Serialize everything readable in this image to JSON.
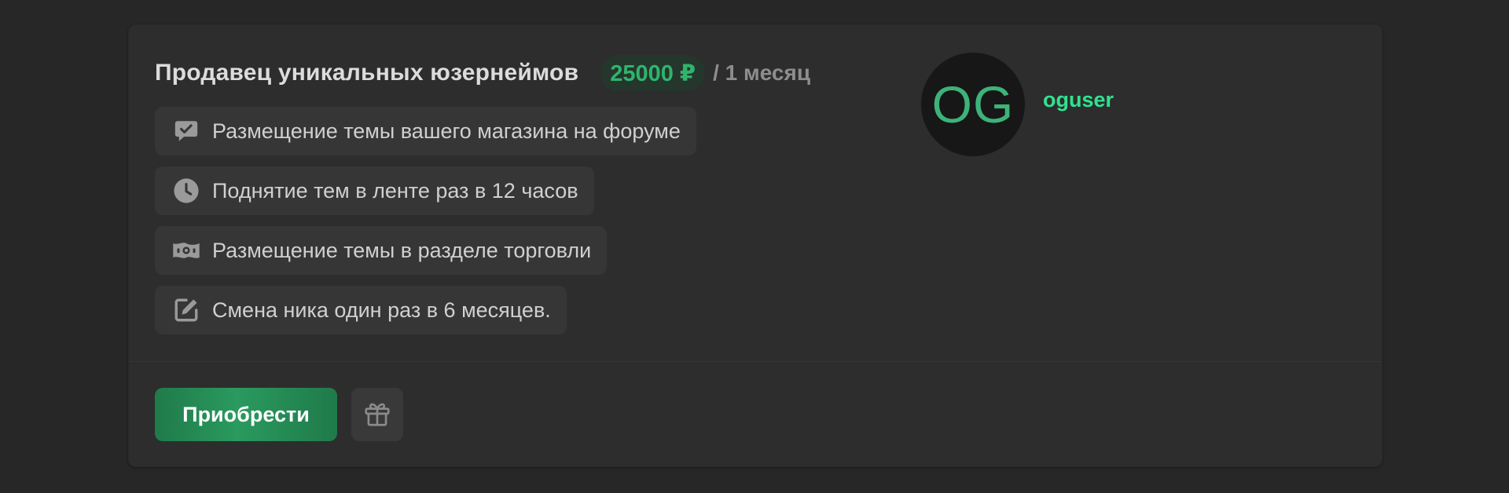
{
  "subscription": {
    "title": "Продавец уникальных юзернеймов",
    "price": "25000 ₽",
    "period": "/ 1 месяц"
  },
  "features": [
    {
      "icon": "chat-check-icon",
      "label": "Размещение темы вашего магазина на форуме"
    },
    {
      "icon": "clock-icon",
      "label": "Поднятие тем в ленте раз в 12 часов"
    },
    {
      "icon": "money-bill-icon",
      "label": "Размещение темы в разделе торговли"
    },
    {
      "icon": "edit-icon",
      "label": "Смена ника один раз в 6 месяцев."
    }
  ],
  "seller": {
    "avatar_initials": "OG",
    "username": "oguser"
  },
  "actions": {
    "buy_label": "Приобрести",
    "gift_icon": "gift-icon"
  },
  "colors": {
    "background": "#272727",
    "card": "#2d2d2d",
    "accent_green": "#2fb46d",
    "username_green": "#2fe38f",
    "button_green": "#2a9a5e",
    "feature_bg": "#363636",
    "icon_gray": "#9a9a9a"
  }
}
